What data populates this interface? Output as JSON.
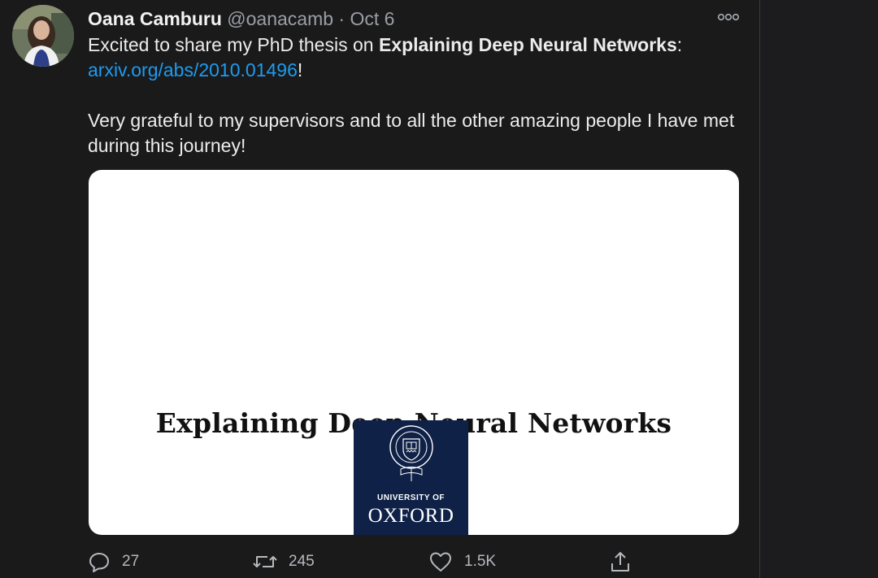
{
  "tweet": {
    "author_name": "Oana Camburu",
    "author_handle": "@oanacamb",
    "separator": "·",
    "date": "Oct 6",
    "text_part1": "Excited to share my PhD thesis on ",
    "text_bold": "Explaining Deep Neural Networks",
    "text_part2": ":",
    "link": "arxiv.org/abs/2010.01496",
    "link_suffix": "!",
    "paragraph2": "Very grateful to my supervisors and to all the other amazing people I have met during this journey!"
  },
  "media": {
    "thesis_title": "Explaining Deep Neural Networks",
    "logo_line1": "UNIVERSITY OF",
    "logo_line2": "OXFORD"
  },
  "actions": {
    "replies": "27",
    "retweets": "245",
    "likes": "1.5K"
  },
  "icons": {
    "more": "more-dots-icon",
    "reply": "reply-icon",
    "retweet": "retweet-icon",
    "like": "heart-icon",
    "share": "share-icon"
  },
  "colors": {
    "background": "#1a1a1b",
    "link": "#1d9bf0",
    "secondary_text": "#9a9fa5",
    "oxford_blue": "#0f2147"
  }
}
